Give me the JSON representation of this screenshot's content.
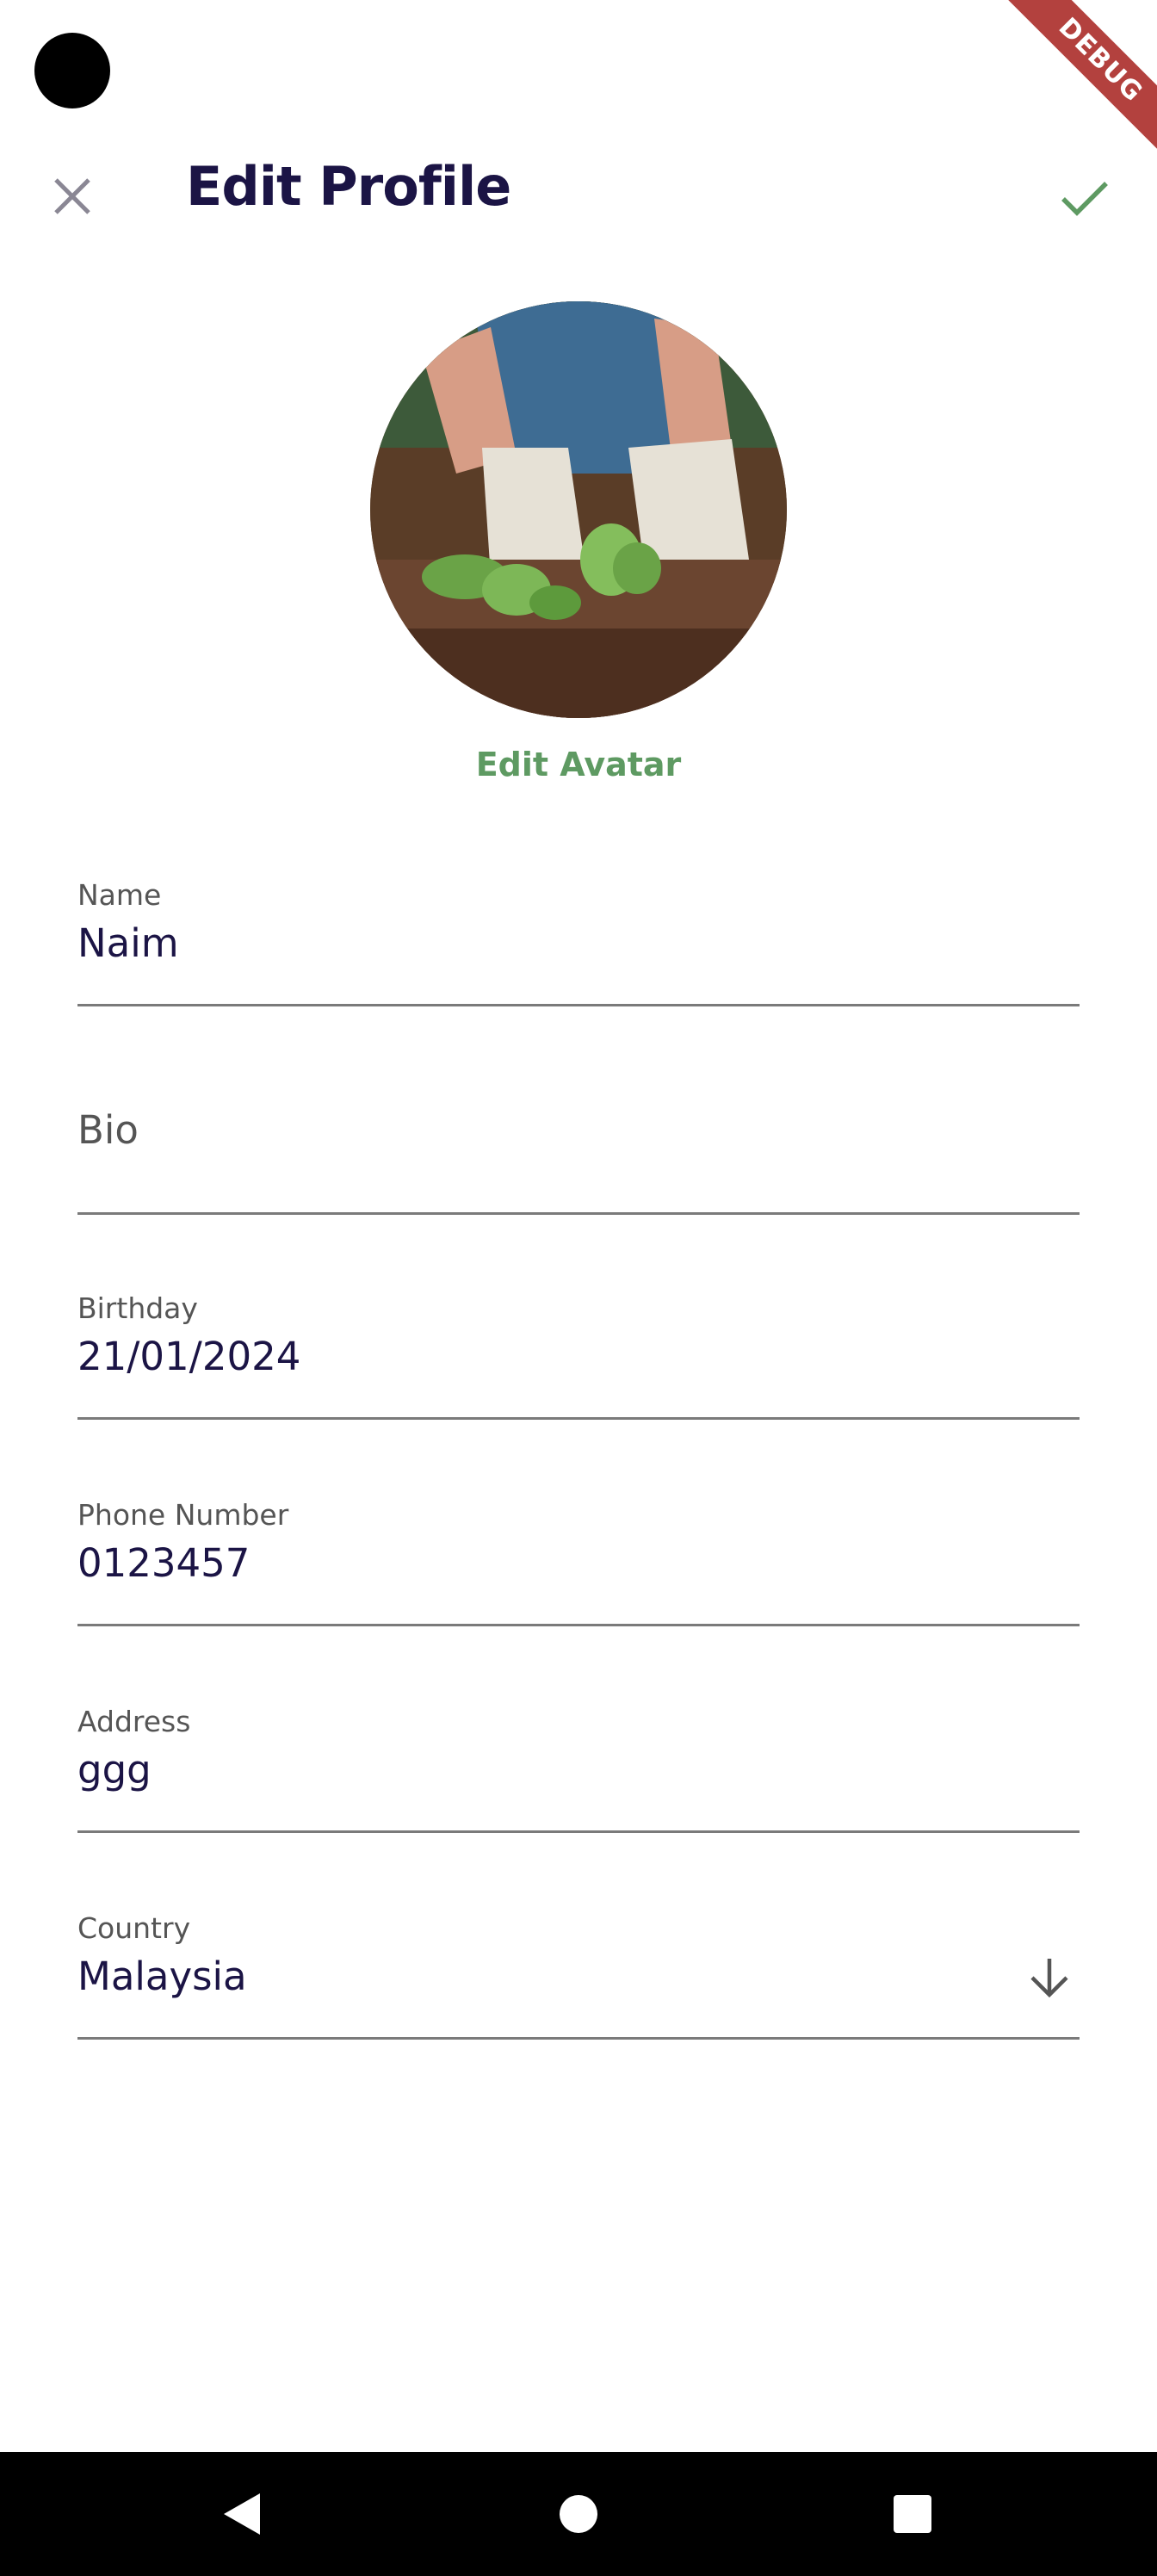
{
  "app": {
    "debug_badge": "DEBUG",
    "accent_color": "#5e9a62",
    "title_color": "#1b1445"
  },
  "header": {
    "title": "Edit Profile",
    "close_icon": "close-icon",
    "save_icon": "check-icon"
  },
  "avatar": {
    "edit_label": "Edit Avatar",
    "image_description": "gardening-hands-photo"
  },
  "fields": {
    "name": {
      "label": "Name",
      "value": "Naim"
    },
    "bio": {
      "placeholder": "Bio",
      "value": ""
    },
    "birthday": {
      "label": "Birthday",
      "value": "21/01/2024"
    },
    "phone": {
      "label": "Phone Number",
      "value": "0123457"
    },
    "address": {
      "label": "Address",
      "value": "ggg"
    },
    "country": {
      "label": "Country",
      "value": "Malaysia",
      "icon": "arrow-down-icon"
    }
  },
  "navigation": {
    "back_icon": "back-icon",
    "home_icon": "home-icon",
    "recents_icon": "recents-icon"
  }
}
